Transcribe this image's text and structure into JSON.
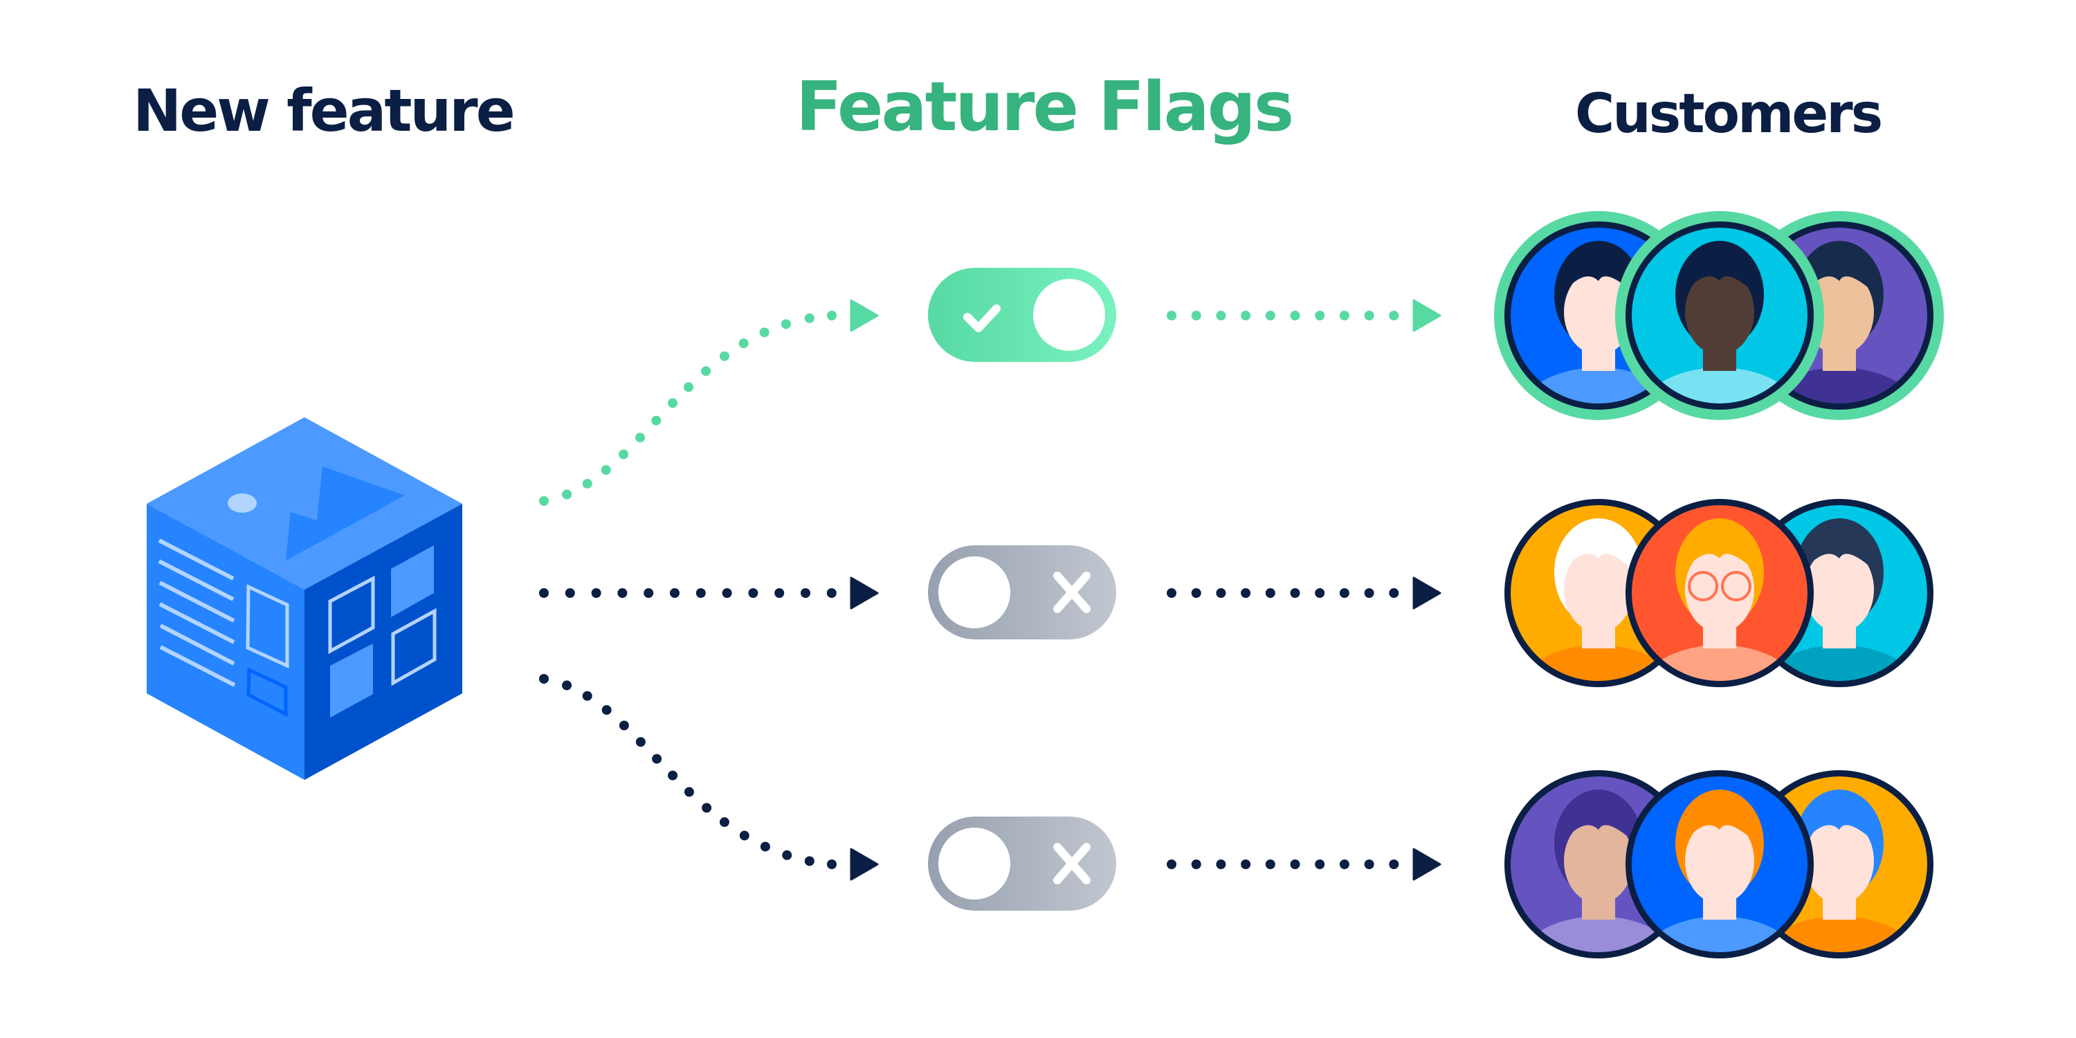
{
  "headings": {
    "new_feature": "New feature",
    "feature_flags": "Feature Flags",
    "customers": "Customers"
  },
  "colors": {
    "navy": "#0b1f44",
    "green": "#57d9a3",
    "title_green": "#36b37e",
    "cube_left": "#2684ff",
    "cube_top": "#4c9aff",
    "cube_right": "#0052cc",
    "cube_accent": "#b3d4ff",
    "toggle_on_start": "#57d9a3",
    "toggle_on_end": "#79f2c0",
    "toggle_off_start": "#97a0af",
    "toggle_off_end": "#c1c7d0"
  },
  "flags": [
    {
      "name": "flag-1",
      "state": "on",
      "icon": "check-icon",
      "route_color": "green"
    },
    {
      "name": "flag-2",
      "state": "off",
      "icon": "x-icon",
      "route_color": "navy"
    },
    {
      "name": "flag-3",
      "state": "off",
      "icon": "x-icon",
      "route_color": "navy"
    }
  ],
  "customer_groups": [
    {
      "name": "customers-enabled",
      "highlighted": true,
      "avatars": [
        {
          "label": "woman-dark-hair",
          "bg": "#0065ff",
          "skin": "#ffe2d9",
          "hair": "#0b1f44",
          "shirt": "#4c9aff"
        },
        {
          "label": "man-curly-hair",
          "bg": "#00c7e6",
          "skin": "#523d36",
          "hair": "#0b1f44",
          "shirt": "#79e2f2"
        },
        {
          "label": "man-short-hair",
          "bg": "#6554c0",
          "skin": "#ecc19c",
          "hair": "#172b4d",
          "shirt": "#403294"
        }
      ]
    },
    {
      "name": "customers-disabled-1",
      "highlighted": false,
      "avatars": [
        {
          "label": "woman-white-hair",
          "bg": "#ffab00",
          "skin": "#ffe2d9",
          "hair": "#ffffff",
          "shirt": "#ff8b00"
        },
        {
          "label": "woman-glasses",
          "bg": "#ff5630",
          "skin": "#ffe2d9",
          "hair": "#ffab00",
          "shirt": "#ffa383"
        },
        {
          "label": "woman-bob-hair",
          "bg": "#00c7e6",
          "skin": "#ffe2d9",
          "hair": "#253858",
          "shirt": "#00a3bf"
        }
      ]
    },
    {
      "name": "customers-disabled-2",
      "highlighted": false,
      "avatars": [
        {
          "label": "woman-hijab",
          "bg": "#6554c0",
          "skin": "#e2b59c",
          "hair": "#403294",
          "shirt": "#998dd9"
        },
        {
          "label": "man-orange-hair",
          "bg": "#0065ff",
          "skin": "#ffe2d9",
          "hair": "#ff8b00",
          "shirt": "#4c9aff"
        },
        {
          "label": "person-blue-hair",
          "bg": "#ffab00",
          "skin": "#ffe2d9",
          "hair": "#2684ff",
          "shirt": "#ff8b00"
        }
      ]
    }
  ]
}
